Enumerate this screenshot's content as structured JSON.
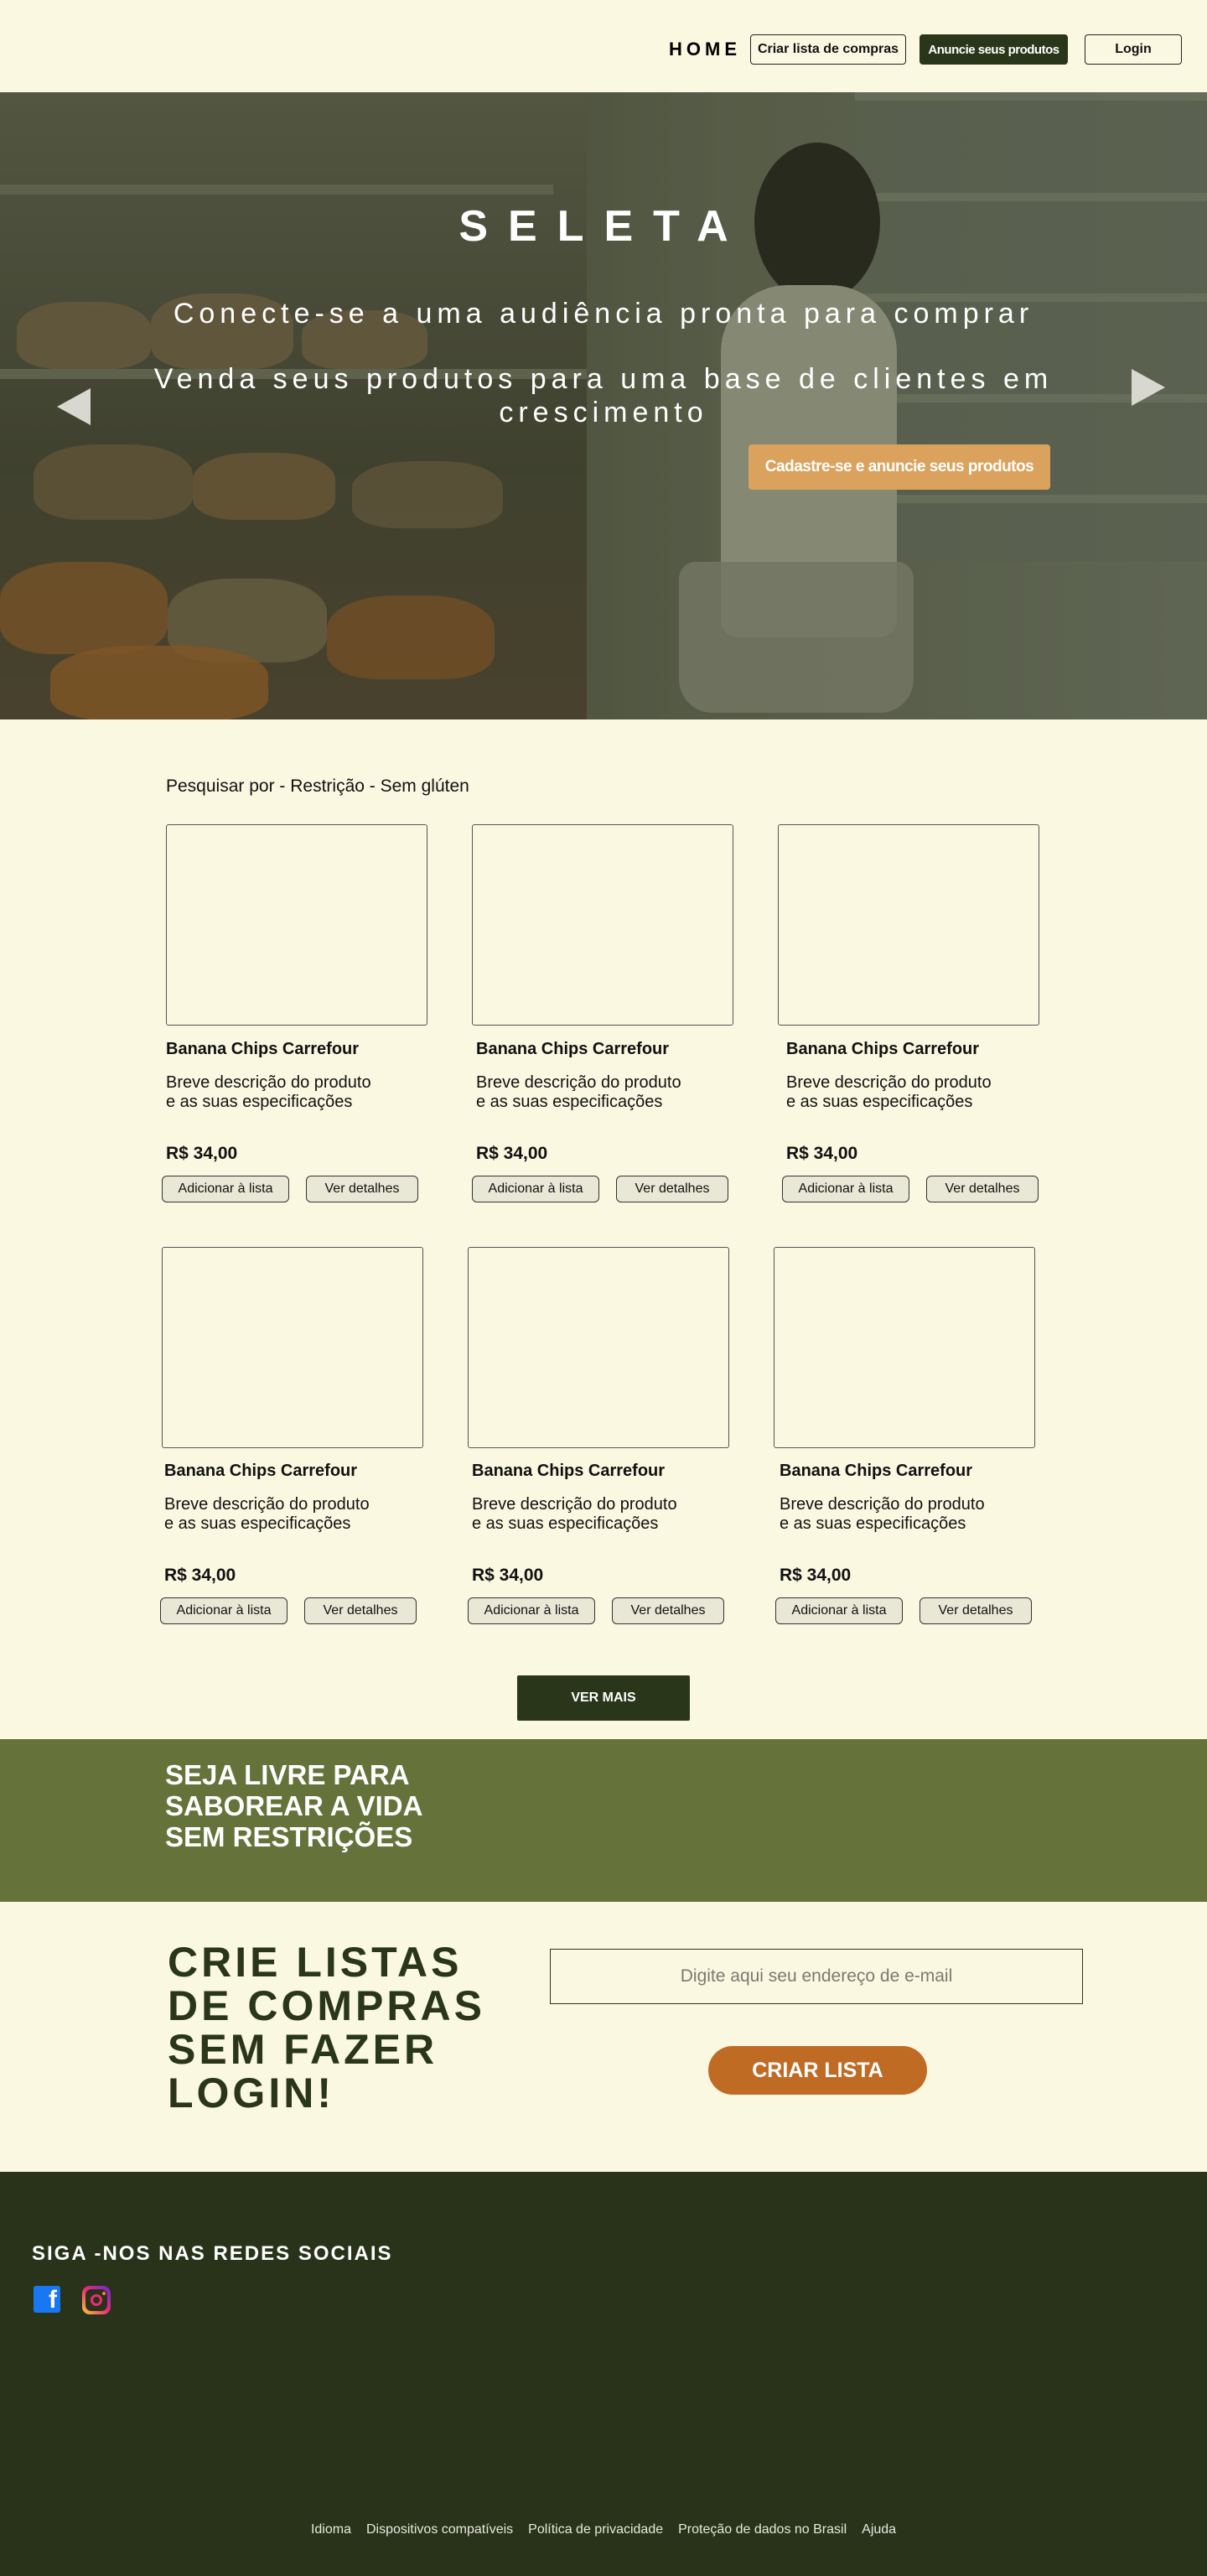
{
  "header": {
    "home": "HOME",
    "criar_lista": "Criar lista de compras",
    "anuncie": "Anuncie seus produtos",
    "login": "Login"
  },
  "hero": {
    "title": "SELETA",
    "line1": "Conecte-se a uma audiência pronta para comprar",
    "line2": "Venda seus produtos para uma base de clientes em crescimento",
    "cta": "Cadastre-se e anuncie seus produtos"
  },
  "search": {
    "label": "Pesquisar por - Restrição - Sem glúten"
  },
  "products": [
    {
      "title": "Banana Chips Carrefour",
      "desc": "Breve descrição do produto e as suas especificações",
      "price": "R$ 34,00",
      "add": "Adicionar à lista",
      "details": "Ver detalhes"
    },
    {
      "title": "Banana Chips Carrefour",
      "desc": "Breve descrição do produto e as suas especificações",
      "price": "R$ 34,00",
      "add": "Adicionar à lista",
      "details": "Ver detalhes"
    },
    {
      "title": "Banana Chips Carrefour",
      "desc": "Breve descrição do produto e as suas especificações",
      "price": "R$ 34,00",
      "add": "Adicionar à lista",
      "details": "Ver detalhes"
    },
    {
      "title": "Banana Chips Carrefour",
      "desc": "Breve descrição do produto e as suas especificações",
      "price": "R$ 34,00",
      "add": "Adicionar à lista",
      "details": "Ver detalhes"
    },
    {
      "title": "Banana Chips Carrefour",
      "desc": "Breve descrição do produto e as suas especificações",
      "price": "R$ 34,00",
      "add": "Adicionar à lista",
      "details": "Ver detalhes"
    },
    {
      "title": "Banana Chips Carrefour",
      "desc": "Breve descrição do produto e as suas especificações",
      "price": "R$ 34,00",
      "add": "Adicionar à lista",
      "details": "Ver detalhes"
    }
  ],
  "ver_mais": "VER MAIS",
  "banner": {
    "text": "SEJA LIVRE PARA SABOREAR A VIDA SEM RESTRIÇÕES"
  },
  "lista": {
    "title": "CRIE LISTAS DE COMPRAS SEM FAZER LOGIN!",
    "email_placeholder": "Digite aqui seu endereço de e-mail",
    "button": "CRIAR LISTA"
  },
  "footer": {
    "social_title": "SIGA -NOS NAS REDES SOCIAIS",
    "links": [
      "Idioma",
      "Dispositivos compatíveis",
      "Política de privacidade",
      "Proteção de dados no Brasil",
      "Ajuda"
    ]
  },
  "colors": {
    "background": "#faf8e1",
    "dark_green": "#2a3619",
    "olive": "#65733a",
    "orange": "#c06b24",
    "cta_tan": "#dba25d",
    "footer": "#283319"
  },
  "icons": [
    "arrow-left-icon",
    "arrow-right-icon",
    "facebook-icon",
    "instagram-icon"
  ]
}
